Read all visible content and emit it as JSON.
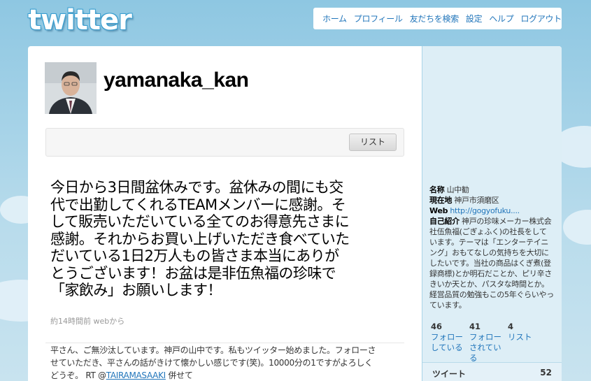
{
  "logo_text": "twitter",
  "nav": {
    "items": [
      "ホーム",
      "プロフィール",
      "友だちを検索",
      "設定",
      "ヘルプ",
      "ログアウト"
    ]
  },
  "profile": {
    "username": "yamanaka_kan",
    "list_button": "リスト"
  },
  "latest_tweet": {
    "text": "今日から3日間盆休みです。盆休みの間にも交代で出勤してくれるTEAMメンバーに感謝。そして販売いただいている全てのお得意先さまに感謝。それからお買い上げいただき食べていただいている1日2万人もの皆さま本当にありがとうございます！お盆は是非伍魚福の珍味で「家飲み」お願いします！",
    "time": "約14時間前",
    "source": "webから"
  },
  "next_tweet": {
    "text": "平さん、ご無沙汰しています。神戸の山中です。私もツイッター始めました。フォローさせていただき、平さんの話がきけて懐かしい感じです(笑)。10000分の1ですがよろしくどうぞ。 RT @",
    "mention": "TAIRAMASAAKI",
    "suffix": " 併せて"
  },
  "sidebar": {
    "name_label": "名称",
    "name_value": "山中勧",
    "location_label": "現在地",
    "location_value": "神戸市須磨区",
    "web_label": "Web",
    "web_value": "http://gogyofuku....",
    "bio_label": "自己紹介",
    "bio_value": "神戸の珍味メーカー株式会社伍魚福(ごぎょふく)の社長をしています。テーマは「エンターテイニング」おもてなしの気持ちを大切にしたいです。当社の商品はくぎ煮(登録商標)とか明石だことか、ピリ辛さきいか天とか、パスタな時間とか。経営品質の勉強もこの5年ぐらいやっています。",
    "stats": [
      {
        "num": "46",
        "label": "フォロー している"
      },
      {
        "num": "41",
        "label": "フォロー されている"
      },
      {
        "num": "4",
        "label": "リスト"
      }
    ],
    "tweets_label": "ツイート",
    "tweets_count": "52"
  },
  "colors": {
    "link": "#2276bb",
    "sky": "#8ec7e2",
    "sidebar_bg": "#ddeef6"
  }
}
